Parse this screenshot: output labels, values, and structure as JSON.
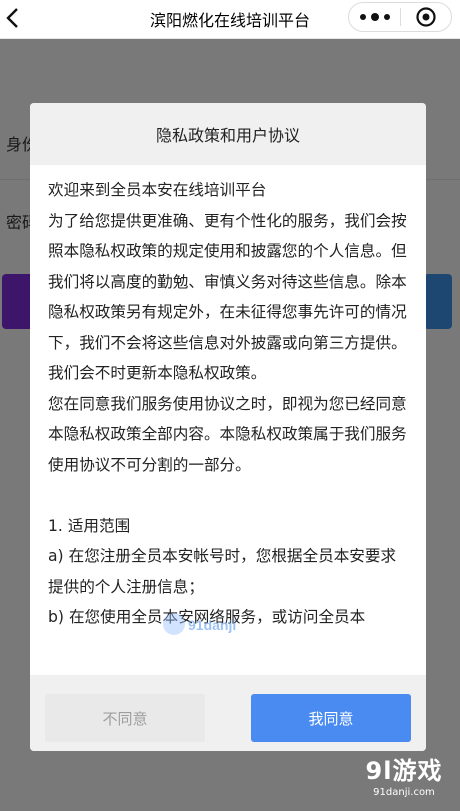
{
  "navbar": {
    "title": "滨阳燃化在线培训平台",
    "back_icon": "chevron-left-icon",
    "more_icon": "more-dots-icon",
    "close_icon": "target-circle-icon"
  },
  "background_page": {
    "row1_label": "身份",
    "row2_label": "密码",
    "colors": {
      "left_button": "#7a2bd6",
      "right_button": "#3b8ce3"
    }
  },
  "dialog": {
    "title": "隐私政策和用户协议",
    "paragraphs": [
      "欢迎来到全员本安在线培训平台",
      "为了给您提供更准确、更有个性化的服务，我们会按照本隐私权政策的规定使用和披露您的个人信息。但我们将以高度的勤勉、审慎义务对待这些信息。除本隐私权政策另有规定外，在未征得您事先许可的情况下，我们不会将这些信息对外披露或向第三方提供。我们会不时更新本隐私权政策。",
      "您在同意我们服务使用协议之时，即视为您已经同意本隐私权政策全部内容。本隐私权政策属于我们服务使用协议不可分割的一部分。",
      "",
      "1. 适用范围",
      "a) 在您注册全员本安帐号时，您根据全员本安要求提供的个人注册信息；",
      "b) 在您使用全员本安网络服务，或访问全员本"
    ],
    "disagree_label": "不同意",
    "agree_label": "我同意",
    "colors": {
      "agree": "#4a8bf2",
      "disagree_bg": "#e9e9e9",
      "disagree_text": "#9e9e9e"
    }
  },
  "watermarks": {
    "center_text": "91danji",
    "corner_big": "9l游戏",
    "corner_small": "91danji.com"
  }
}
